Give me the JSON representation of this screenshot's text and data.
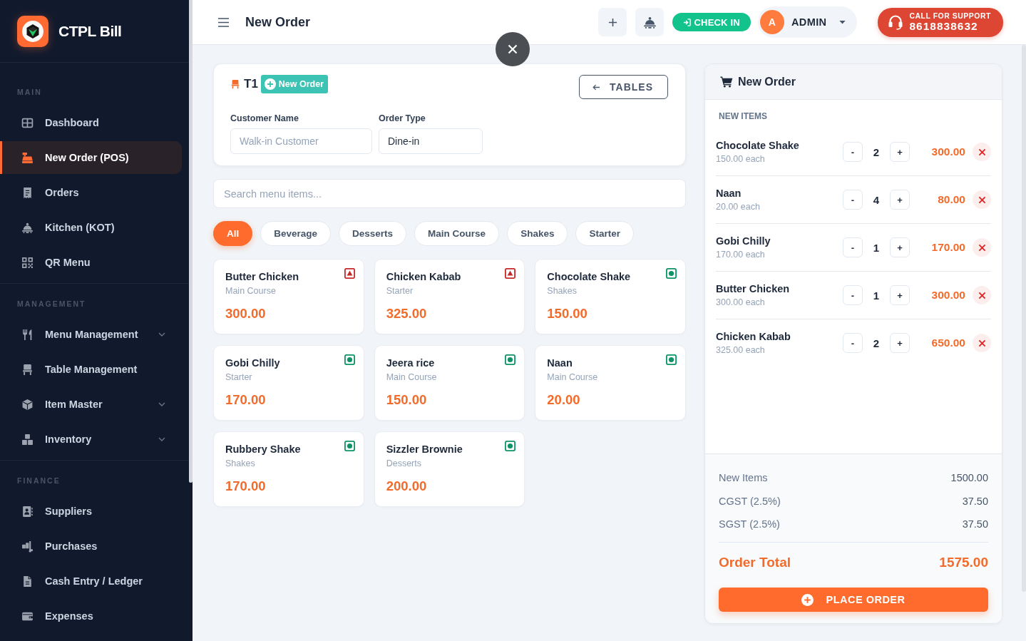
{
  "sidebar": {
    "brand": "CTPL Bill",
    "sections": [
      {
        "title": "MAIN",
        "items": [
          {
            "label": "Dashboard",
            "kind": "link",
            "selected": false
          },
          {
            "label": "New Order (POS)",
            "kind": "link",
            "selected": true
          },
          {
            "label": "Orders",
            "kind": "link",
            "selected": false
          },
          {
            "label": "Kitchen (KOT)",
            "kind": "link",
            "selected": false
          },
          {
            "label": "QR Menu",
            "kind": "link",
            "selected": false
          }
        ]
      },
      {
        "title": "MANAGEMENT",
        "items": [
          {
            "label": "Menu Management",
            "kind": "group",
            "selected": false
          },
          {
            "label": "Table Management",
            "kind": "link",
            "selected": false
          },
          {
            "label": "Item Master",
            "kind": "group",
            "selected": false
          },
          {
            "label": "Inventory",
            "kind": "group",
            "selected": false
          }
        ]
      },
      {
        "title": "FINANCE",
        "items": [
          {
            "label": "Suppliers",
            "kind": "link",
            "selected": false
          },
          {
            "label": "Purchases",
            "kind": "link",
            "selected": false
          },
          {
            "label": "Cash Entry / Ledger",
            "kind": "link",
            "selected": false
          },
          {
            "label": "Expenses",
            "kind": "link",
            "selected": false
          }
        ]
      }
    ]
  },
  "header": {
    "title": "New Order",
    "check_in": "CHECK IN",
    "user": {
      "initial": "A",
      "name": "ADMIN"
    },
    "support": {
      "caption": "CALL FOR SUPPORT",
      "phone": "8618838632"
    }
  },
  "order": {
    "table": "T1",
    "new_order": "New Order",
    "back": "TABLES",
    "fields": [
      {
        "label": "Customer Name",
        "placeholder": "Walk-in Customer"
      },
      {
        "label": "Order Type",
        "value": "Dine-in"
      }
    ]
  },
  "search": {
    "placeholder": "Search menu items..."
  },
  "categories": [
    {
      "label": "All",
      "selected": true
    },
    {
      "label": "Beverage",
      "selected": false
    },
    {
      "label": "Desserts",
      "selected": false
    },
    {
      "label": "Main Course",
      "selected": false
    },
    {
      "label": "Shakes",
      "selected": false
    },
    {
      "label": "Starter",
      "selected": false
    }
  ],
  "menu_items": [
    {
      "name": "Butter Chicken",
      "category": "Main Course",
      "price": "300.00",
      "veg": false
    },
    {
      "name": "Chicken Kabab",
      "category": "Starter",
      "price": "325.00",
      "veg": false
    },
    {
      "name": "Chocolate Shake",
      "category": "Shakes",
      "price": "150.00",
      "veg": true
    },
    {
      "name": "Gobi Chilly",
      "category": "Starter",
      "price": "170.00",
      "veg": true
    },
    {
      "name": "Jeera rice",
      "category": "Main Course",
      "price": "150.00",
      "veg": true
    },
    {
      "name": "Naan",
      "category": "Main Course",
      "price": "20.00",
      "veg": true
    },
    {
      "name": "Rubbery Shake",
      "category": "Shakes",
      "price": "170.00",
      "veg": true
    },
    {
      "name": "Sizzler Brownie",
      "category": "Desserts",
      "price": "200.00",
      "veg": true
    }
  ],
  "cart": {
    "title": "New Order",
    "section": "NEW ITEMS",
    "items": [
      {
        "name": "Chocolate Shake",
        "unit_price": "150.00 each",
        "decrement": "-",
        "quantity": "2",
        "increment": "+",
        "amount": "300.00"
      },
      {
        "name": "Naan",
        "unit_price": "20.00 each",
        "decrement": "-",
        "quantity": "4",
        "increment": "+",
        "amount": "80.00"
      },
      {
        "name": "Gobi Chilly",
        "unit_price": "170.00 each",
        "decrement": "-",
        "quantity": "1",
        "increment": "+",
        "amount": "170.00"
      },
      {
        "name": "Butter Chicken",
        "unit_price": "300.00 each",
        "decrement": "-",
        "quantity": "1",
        "increment": "+",
        "amount": "300.00"
      },
      {
        "name": "Chicken Kabab",
        "unit_price": "325.00 each",
        "decrement": "-",
        "quantity": "2",
        "increment": "+",
        "amount": "650.00"
      }
    ],
    "summary": [
      {
        "label": "New Items",
        "value": "1500.00"
      },
      {
        "label": "CGST (2.5%)",
        "value": "37.50"
      },
      {
        "label": "SGST (2.5%)",
        "value": "37.50"
      }
    ],
    "total": {
      "label": "Order Total",
      "value": "1575.00"
    },
    "submit": "PLACE ORDER"
  }
}
